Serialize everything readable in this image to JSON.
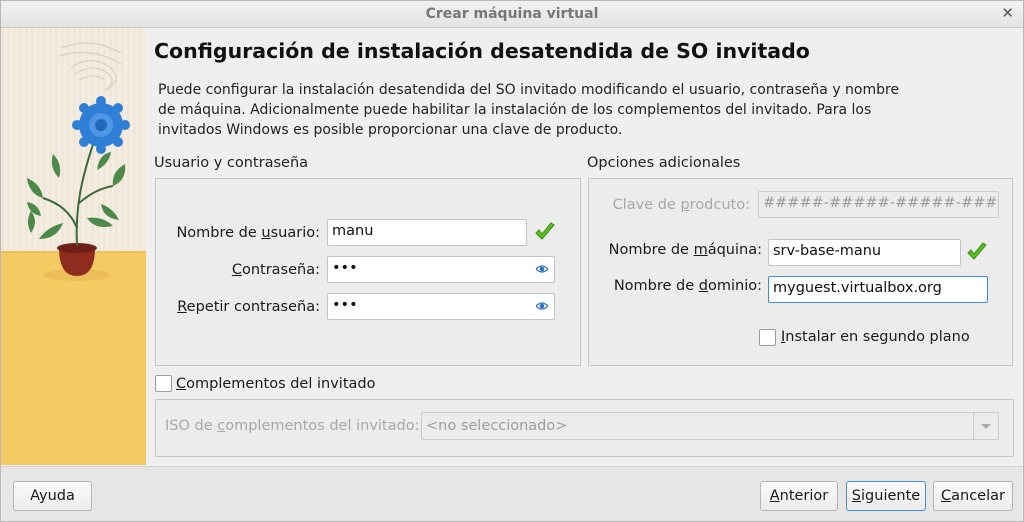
{
  "window": {
    "title": "Crear máquina virtual",
    "close_glyph": "✕"
  },
  "heading": "Configuración de instalación desatendida de SO invitado",
  "description": "Puede configurar la instalación desatendida del SO invitado modificando el usuario, contraseña y nombre de máquina. Adicionalmente puede habilitar la instalación de los complementos del invitado. Para los invitados Windows es posible proporcionar una clave de producto.",
  "user_group": {
    "title": "Usuario y contraseña",
    "username": {
      "label_pre": "Nombre de ",
      "label_u": "u",
      "label_post": "suario:",
      "value": "manu",
      "valid_icon": "checkmark-icon"
    },
    "password": {
      "label_pre": "",
      "label_u": "C",
      "label_post": "ontraseña:",
      "value": "•••",
      "reveal_icon": "eye-icon"
    },
    "repeat_password": {
      "label_pre": "",
      "label_u": "R",
      "label_post": "epetir contraseña:",
      "value": "•••",
      "reveal_icon": "eye-icon"
    }
  },
  "options_group": {
    "title": "Opciones adicionales",
    "product_key": {
      "label_pre": "Clave de ",
      "label_u": "p",
      "label_post": "rodcuto:",
      "value": "#####-#####-#####-#####-#####"
    },
    "hostname": {
      "label_pre": "Nombre de ",
      "label_u": "m",
      "label_post": "áquina:",
      "value": "srv-base-manu",
      "valid_icon": "checkmark-icon"
    },
    "domain": {
      "label_pre": "Nombre de ",
      "label_u": "d",
      "label_post": "ominio:",
      "value": "myguest.virtualbox.org"
    },
    "background_install": {
      "label_u": "I",
      "label_post": "nstalar en segundo plano",
      "checked": false
    }
  },
  "guest_additions": {
    "label_u": "C",
    "label_post": "omplementos del invitado",
    "checked": false,
    "iso": {
      "label_pre": "ISO de ",
      "label_u": "c",
      "label_post": "omplementos del invitado:",
      "value": "<no seleccionado>"
    }
  },
  "buttons": {
    "help": {
      "u": "",
      "rest": "Ayuda"
    },
    "back": {
      "u": "A",
      "rest": "nterior"
    },
    "next": {
      "u": "S",
      "rest": "iguiente"
    },
    "cancel": {
      "u": "C",
      "rest": "ancelar"
    }
  },
  "colors": {
    "accent": "#3d8ee2",
    "valid": "#5bbf21",
    "wall": "#f3ece0",
    "floor": "#f5c861",
    "petal": "#2f7fd6"
  }
}
